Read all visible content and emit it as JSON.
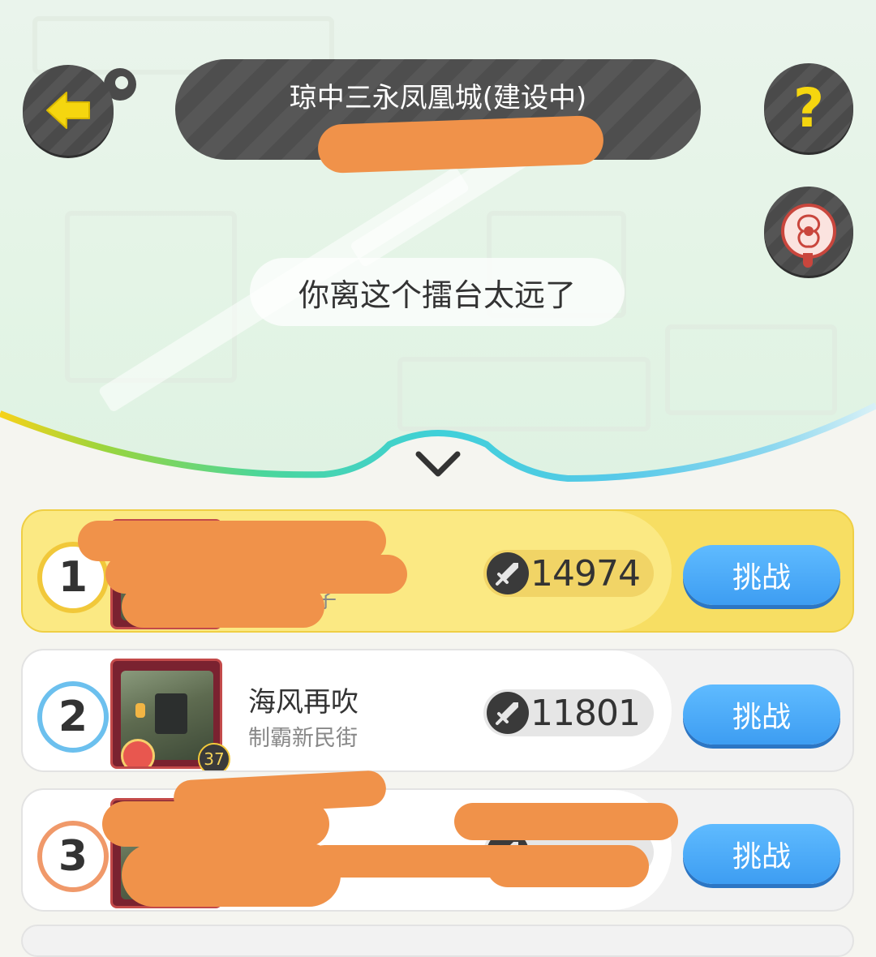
{
  "header": {
    "title": "琼中三永凤凰城(建设中)",
    "subtitle_redacted": true
  },
  "notice": "你离这个擂台太远了",
  "icons": {
    "back": "back-arrow-icon",
    "help": "question-icon",
    "location": "location-pin-icon",
    "collapse": "chevron-down-icon",
    "score": "sword-icon"
  },
  "colors": {
    "accent_yellow": "#f2d21a",
    "challenge_blue": "#3d9df2",
    "gold_card": "#f7de63",
    "redaction": "#f0924a"
  },
  "leaderboard": [
    {
      "rank": "1",
      "name": "",
      "group": "子",
      "score": "14974",
      "level": "",
      "button": "挑战",
      "redacted": true
    },
    {
      "rank": "2",
      "name": "海风再吹",
      "group": "制霸新民街",
      "score": "11801",
      "level": "37",
      "button": "挑战",
      "redacted": false
    },
    {
      "rank": "3",
      "name": "",
      "group": "",
      "score": "",
      "level": "",
      "button": "挑战",
      "redacted": true
    }
  ]
}
